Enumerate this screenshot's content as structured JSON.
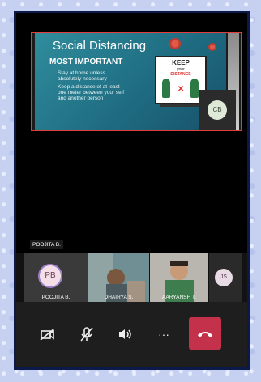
{
  "shared_slide": {
    "title": "Social Distancing",
    "subtitle": "MOST IMPORTANT",
    "bullet1_line1": "Stay at home unless",
    "bullet1_line2": "absolutely necessary",
    "bullet2_line1": "Keep  a distance of at least",
    "bullet2_line2": "one meter between your self",
    "bullet2_line3": "and another person",
    "sign_keep": "KEEP",
    "sign_your": "your",
    "sign_distance": "DISTANCE"
  },
  "presenter_tile": {
    "initials": "CB"
  },
  "active_speaker_label": "POOJITA B.",
  "participants": [
    {
      "initials": "PB",
      "name": "POOJITA B."
    },
    {
      "name": "DHAIRYA S."
    },
    {
      "name": "AARYANSH T."
    },
    {
      "initials": "JS"
    }
  ],
  "controls": {
    "camera": "camera-off-icon",
    "mic": "mic-off-icon",
    "speaker": "speaker-icon",
    "more": "···",
    "end_call_color": "#c4314b"
  }
}
